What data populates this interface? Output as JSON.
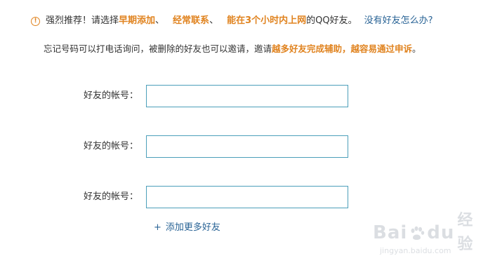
{
  "tip": {
    "icon": "warning-circle-icon",
    "prefix": "强烈推荐！请选择",
    "em1": "早期添加",
    "sep1": "、",
    "em2": "经常联系",
    "sep2": "、",
    "em3": "能在3个小时内上网",
    "suffix": "的QQ好友。",
    "help_link": "没有好友怎么办?"
  },
  "info": {
    "text": "忘记号码可以打电话询问，被删除的好友也可以邀请，邀请",
    "em": "越多好友完成辅助，越容易通过申诉",
    "end": "。"
  },
  "form": {
    "fields": [
      {
        "label": "好友的帐号：",
        "value": "",
        "placeholder": ""
      },
      {
        "label": "好友的帐号：",
        "value": "",
        "placeholder": ""
      },
      {
        "label": "好友的帐号：",
        "value": "",
        "placeholder": ""
      }
    ],
    "add_more": "添加更多好友",
    "add_more_prefix": "+"
  },
  "watermark": {
    "brand_left": "Bai",
    "brand_mid": "du",
    "brand_right": "经验",
    "sub": "jingyan.baidu.com"
  },
  "colors": {
    "accent_orange": "#e0831f",
    "link_blue": "#2a6496",
    "input_border": "#4c9fba"
  }
}
